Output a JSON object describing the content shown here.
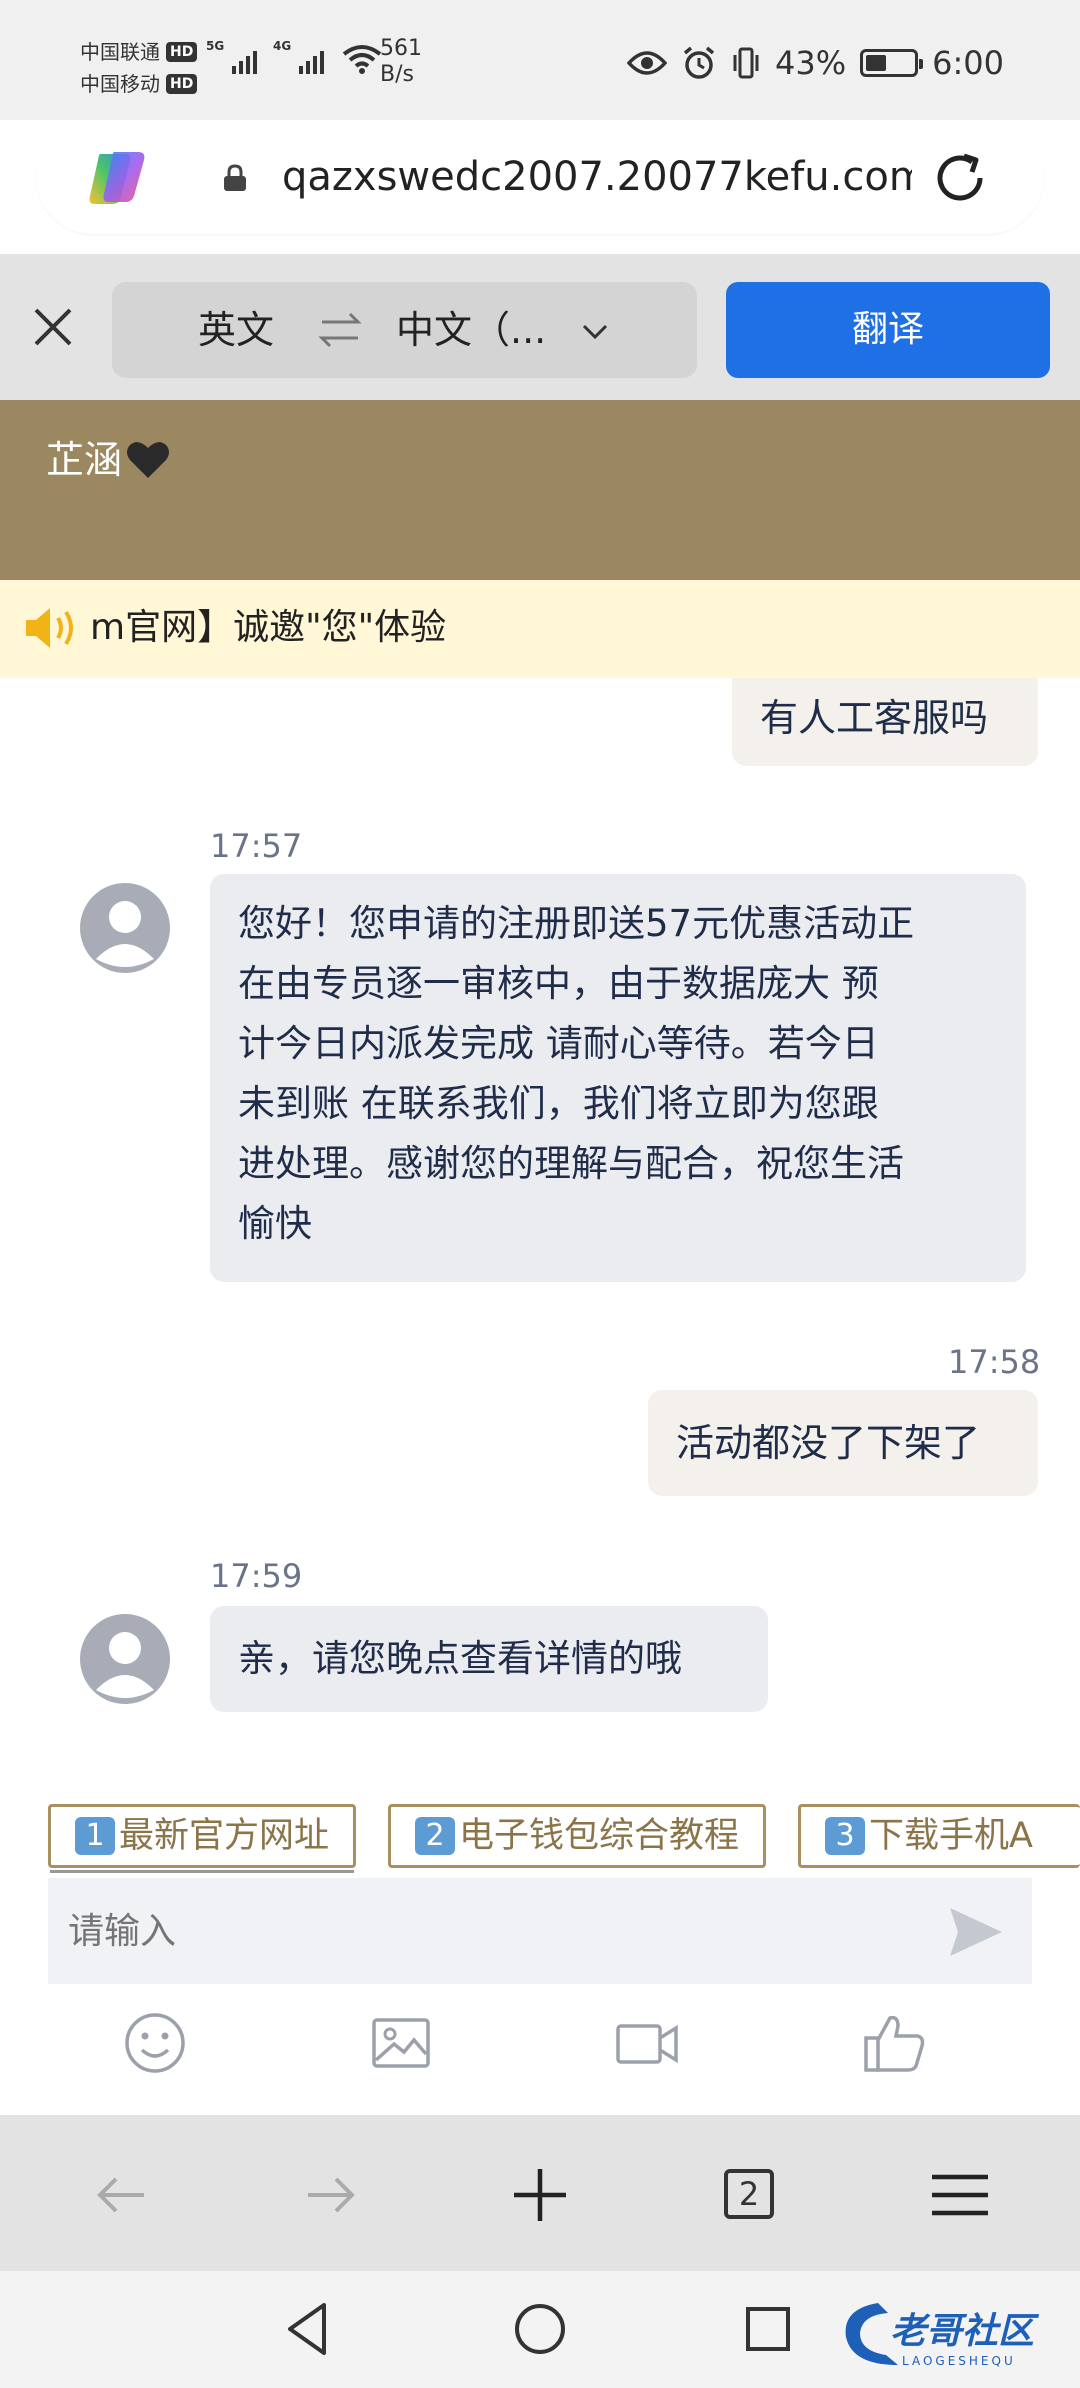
{
  "status_bar": {
    "carrier1": "中国联通",
    "carrier2": "中国移动",
    "hd": "HD",
    "sig1_tag": "5G",
    "sig2_tag": "4G",
    "net_speed_value": "561",
    "net_speed_unit": "B/s",
    "battery_percent": "43%",
    "battery_level": 0.43,
    "time": "6:00"
  },
  "url_bar": {
    "url": "qazxswedc2007.20077kefu.com"
  },
  "translate_bar": {
    "from_lang": "英文",
    "to_lang": "中文（...",
    "translate_label": "翻译"
  },
  "chat": {
    "title": "芷涵",
    "header_color": "#9b8760",
    "notice": "m官网】诚邀\"您\"体验"
  },
  "messages": [
    {
      "direction": "out",
      "text": "有人工客服吗"
    },
    {
      "direction": "in",
      "time": "17:57",
      "lines": [
        "您好！您申请的注册即送57元优惠活动正",
        "在由专员逐一审核中，由于数据庞大 预",
        "计今日内派发完成 请耐心等待。若今日",
        "未到账 在联系我们，我们将立即为您跟",
        "进处理。感谢您的理解与配合，祝您生活",
        "愉快"
      ]
    },
    {
      "direction": "out",
      "time": "17:58",
      "text": "活动都没了下架了"
    },
    {
      "direction": "in",
      "time": "17:59",
      "text": "亲，请您晚点查看详情的哦"
    }
  ],
  "quick_replies": [
    {
      "num": "1",
      "label": "最新官方网址"
    },
    {
      "num": "2",
      "label": "电子钱包综合教程"
    },
    {
      "num": "3",
      "label": "下载手机A"
    }
  ],
  "input": {
    "placeholder": "请输入"
  },
  "browser_nav": {
    "tab_count": "2"
  },
  "watermark": {
    "text": "老哥社区",
    "sub": "LAOGESHEQU"
  },
  "colors": {
    "accent": "#1f6fe5",
    "header": "#9b8760",
    "notice_bg": "#fff7d6",
    "bubble_in": "#ebecf0",
    "bubble_out": "#f4f1ed"
  }
}
